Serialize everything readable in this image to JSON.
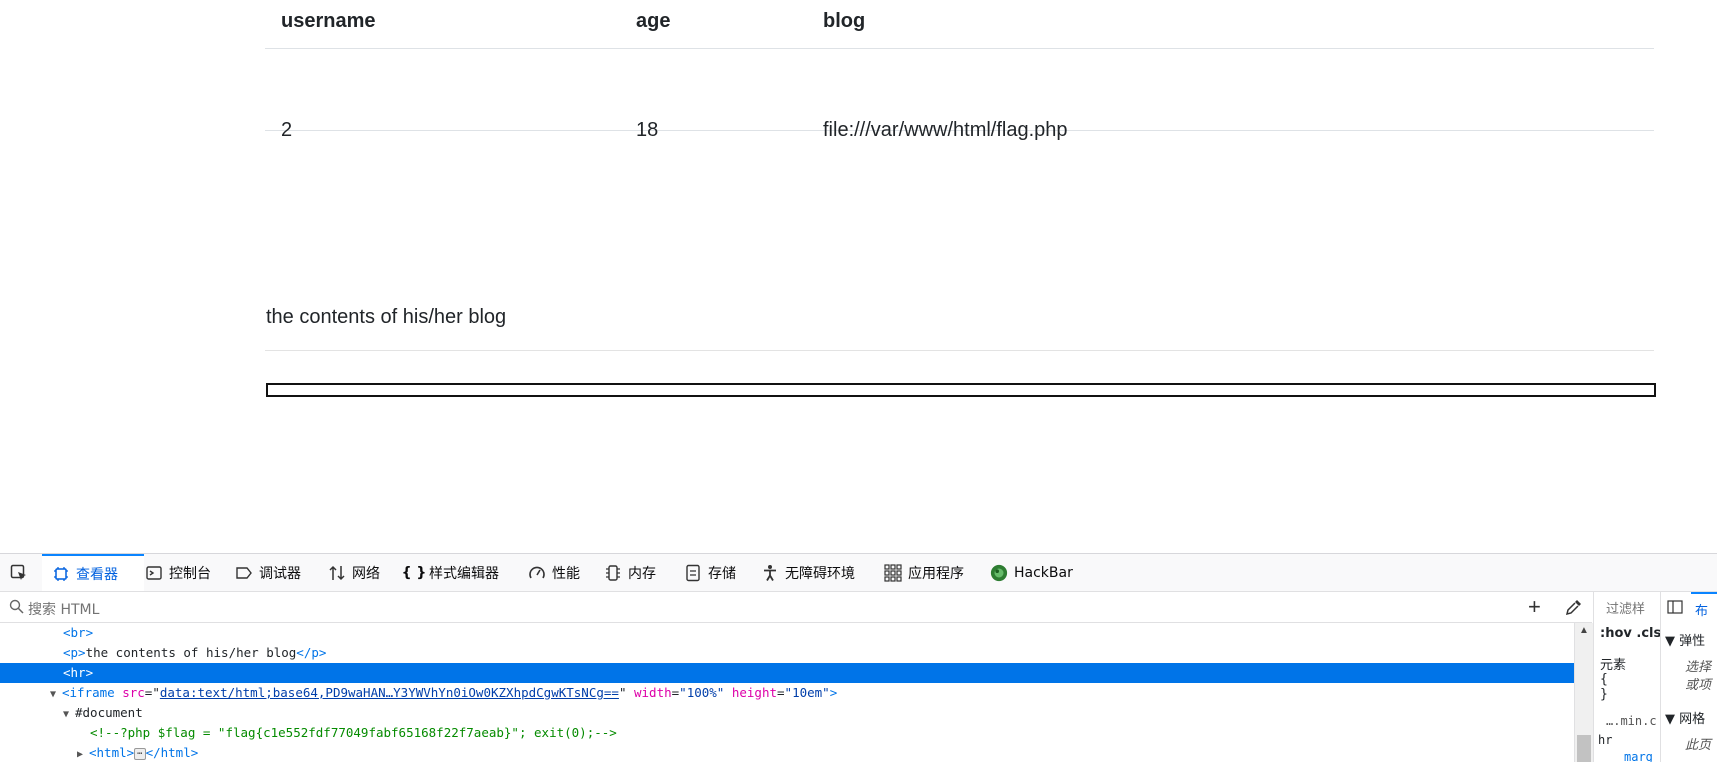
{
  "table": {
    "headers": [
      "username",
      "age",
      "blog"
    ],
    "rows": [
      [
        "2",
        "18",
        "file:///var/www/html/flag.php"
      ]
    ]
  },
  "blog_section": {
    "text": "the contents of his/her blog"
  },
  "devtools": {
    "tabs": [
      "查看器",
      "控制台",
      "调试器",
      "网络",
      "样式编辑器",
      "性能",
      "内存",
      "存储",
      "无障碍环境",
      "应用程序",
      "HackBar"
    ],
    "active_tab": "查看器",
    "search_placeholder": "搜索 HTML",
    "markup": {
      "br": "<br>",
      "p_open": "<p>",
      "p_text": "the contents of his/her blog",
      "p_close": "</p>",
      "hr": "<hr>",
      "iframe_open": "<iframe",
      "src_attr": "src",
      "src_value": "data:text/html;base64,PD9waHAN…Y3YWVhYn0iOw0KZXhpdCgwKTsNCg==",
      "width_attr": "width",
      "width_value": "\"100%\"",
      "height_attr": "height",
      "height_value": "\"10em\"",
      "iframe_close": ">",
      "document": "#document",
      "comment": "<!--?php $flag = \"flag{c1e552fdf77049fabf65168f22f7aeab}\"; exit(0);-->",
      "html_open": "<html>",
      "html_close": "</html>"
    },
    "rules_panel": {
      "filter": "过滤样",
      "hov": ":hov .cls",
      "element": "元素",
      "brace_open": "{",
      "brace_close": "}",
      "source": "….min.c",
      "rule": "hr",
      "prop": "marg"
    },
    "layout_panel": {
      "tab": "布",
      "flex": "弹性",
      "flex_note1": "选择",
      "flex_note2": "或项",
      "grid": "网格",
      "grid_note": "此页"
    }
  }
}
